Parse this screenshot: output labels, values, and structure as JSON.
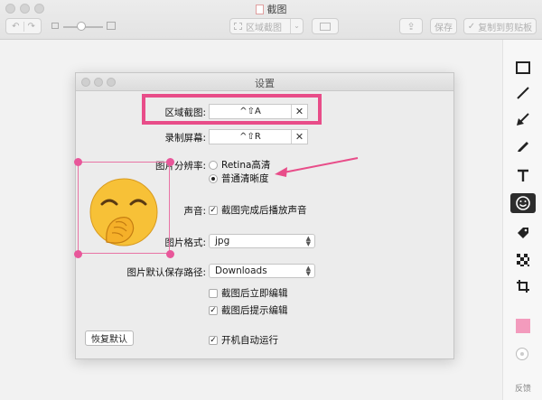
{
  "window": {
    "title": "截图",
    "region_capture_label": "区域截图",
    "save_label": "保存",
    "copy_label": "复制到剪贴板"
  },
  "sidebar": {
    "tools": [
      "rectangle-tool",
      "line-tool",
      "arrow-tool",
      "pen-tool",
      "text-tool",
      "emoji-tool",
      "tag-tool",
      "mosaic-tool",
      "crop-tool"
    ],
    "active_tool": "emoji-tool",
    "color": "#f39bbd",
    "feedback_label": "反馈"
  },
  "dialog": {
    "title": "设置",
    "region_label": "区域截图:",
    "region_hotkey": "^⇧A",
    "record_label": "录制屏幕:",
    "record_hotkey": "^⇧R",
    "resolution_label": "图片分辨率:",
    "resolution_options": [
      "Retina高清",
      "普通清晰度"
    ],
    "resolution_selected": "普通清晰度",
    "sound_label": "声音:",
    "sound_option": "截图完成后播放声音",
    "sound_checked": true,
    "format_label": "图片格式:",
    "format_value": "jpg",
    "path_label": "图片默认保存路径:",
    "path_value": "Downloads",
    "edit_after_label": "截图后立即编辑",
    "edit_after_checked": false,
    "prompt_edit_label": "截图后提示编辑",
    "prompt_edit_checked": true,
    "startup_label": "开机自动运行",
    "startup_checked": true,
    "restore_button": "恢复默认"
  },
  "colors": {
    "annotation_pink": "#e84d89",
    "selection_pink": "#e8579a"
  }
}
